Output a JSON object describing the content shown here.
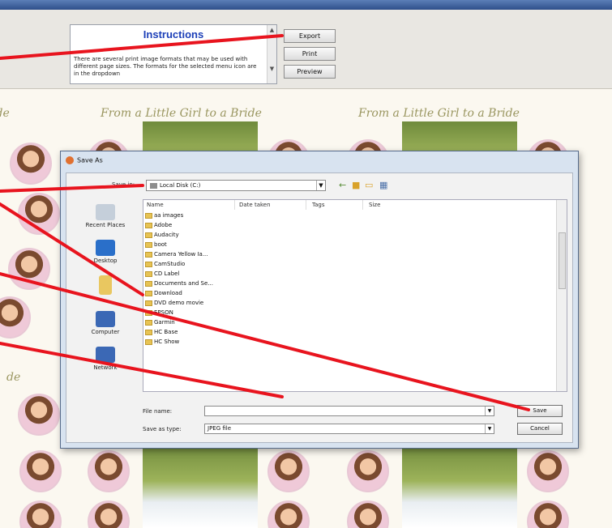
{
  "instructions": {
    "title": "Instructions",
    "text": "There are several print image formats that may be used with different page sizes. The formats for the selected menu icon are in the dropdown"
  },
  "toolbar": {
    "export_label": "Export",
    "print_label": "Print",
    "preview_label": "Preview"
  },
  "page": {
    "caption": "From a Little Girl to a Bride",
    "caption_left_fragment": "ide",
    "caption_lower_fragment": "de"
  },
  "dialog": {
    "title": "Save As",
    "save_in_label": "Save in:",
    "save_in_value": "Local Disk (C:)",
    "places": [
      "Recent Places",
      "Desktop",
      "",
      "Computer",
      "Network"
    ],
    "columns": [
      "Name",
      "Date taken",
      "Tags",
      "Size"
    ],
    "files": [
      "aa images",
      "Adobe",
      "Audacity",
      "boot",
      "Camera Yellow Ia...",
      "CamStudio",
      "CD Label",
      "Documents and Se...",
      "Download",
      "DVD demo movie",
      "EPSON",
      "Garmin",
      "HC Base",
      "HC Show"
    ],
    "file_name_label": "File name:",
    "file_name_value": "",
    "save_type_label": "Save as type:",
    "save_type_value": "JPEG file",
    "save_label": "Save",
    "cancel_label": "Cancel"
  },
  "icons": {
    "scroll_up": "▲",
    "scroll_down": "▼",
    "dropdown": "▼"
  },
  "colors": {
    "callout": "#e8141e",
    "title_blue": "#1c3fb8",
    "caption_olive": "#9a9660"
  }
}
